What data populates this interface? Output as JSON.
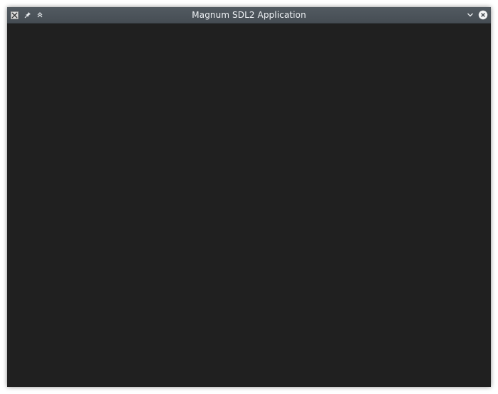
{
  "window": {
    "title": "Magnum SDL2 Application",
    "colors": {
      "titlebar": "#4c5359",
      "title_text": "#eef1f4",
      "canvas": "#202020"
    },
    "icons": {
      "app": "x11-app-icon",
      "pin": "pin-icon",
      "shade": "shade-up-icon",
      "minimize": "chevron-down-icon",
      "close": "close-icon"
    }
  }
}
